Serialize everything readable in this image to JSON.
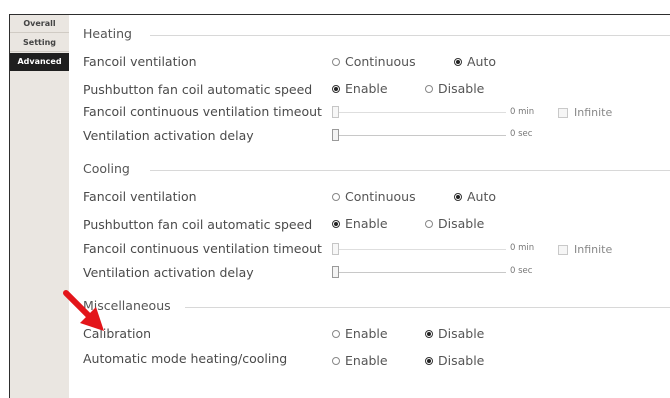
{
  "sidebar": {
    "tabs": [
      {
        "label": "Overall",
        "active": false
      },
      {
        "label": "Setting",
        "active": false
      },
      {
        "label": "Advanced",
        "active": true
      }
    ]
  },
  "heating": {
    "title": "Heating",
    "fancoil_ventilation": {
      "label": "Fancoil ventilation",
      "options": [
        "Continuous",
        "Auto"
      ],
      "selected": "Auto"
    },
    "pushbutton_speed": {
      "label": "Pushbutton fan coil automatic speed",
      "options": [
        "Enable",
        "Disable"
      ],
      "selected": "Enable"
    },
    "continuous_timeout": {
      "label": "Fancoil continuous ventilation timeout",
      "value": "0 min",
      "level": 0,
      "checkbox_label": "Infinite",
      "checked": false
    },
    "activation_delay": {
      "label": "Ventilation activation delay",
      "value": "0 sec",
      "level": 0
    }
  },
  "cooling": {
    "title": "Cooling",
    "fancoil_ventilation": {
      "label": "Fancoil ventilation",
      "options": [
        "Continuous",
        "Auto"
      ],
      "selected": "Auto"
    },
    "pushbutton_speed": {
      "label": "Pushbutton fan coil automatic speed",
      "options": [
        "Enable",
        "Disable"
      ],
      "selected": "Enable"
    },
    "continuous_timeout": {
      "label": "Fancoil continuous ventilation timeout",
      "value": "0 min",
      "level": 0,
      "checkbox_label": "Infinite",
      "checked": false
    },
    "activation_delay": {
      "label": "Ventilation activation delay",
      "value": "0 sec",
      "level": 0
    }
  },
  "miscellaneous": {
    "title": "Miscellaneous",
    "calibration": {
      "label": "Calibration",
      "options": [
        "Enable",
        "Disable"
      ],
      "selected": "Disable"
    },
    "automatic_mode": {
      "label": "Automatic mode heating/cooling",
      "options": [
        "Enable",
        "Disable"
      ],
      "selected": "Disable"
    }
  },
  "colors": {
    "accent_arrow": "#e3151a",
    "active_tab": "#1f1f1f",
    "sidebar": "#eae6e1"
  }
}
